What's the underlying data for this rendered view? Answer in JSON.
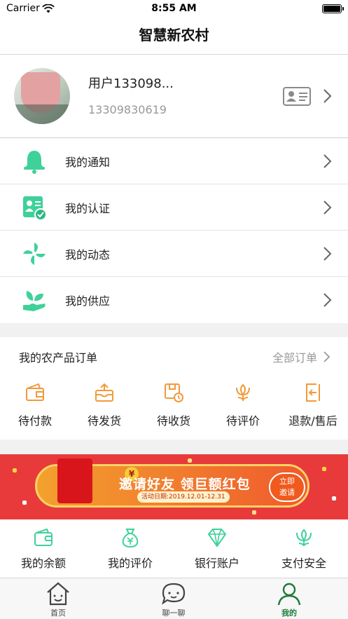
{
  "status_bar": {
    "carrier": "Carrier",
    "time": "8:55 AM"
  },
  "nav": {
    "title": "智慧新农村"
  },
  "profile": {
    "name": "用户133098...",
    "phone": "13309830619"
  },
  "menu": [
    {
      "label": "我的通知",
      "icon": "bell-icon"
    },
    {
      "label": "我的认证",
      "icon": "certification-icon"
    },
    {
      "label": "我的动态",
      "icon": "pinwheel-icon"
    },
    {
      "label": "我的供应",
      "icon": "leaf-hand-icon"
    }
  ],
  "orders": {
    "title": "我的农产品订单",
    "all_label": "全部订单",
    "items": [
      {
        "label": "待付款",
        "icon": "wallet-icon"
      },
      {
        "label": "待发货",
        "icon": "outbox-icon"
      },
      {
        "label": "待收货",
        "icon": "package-clock-icon"
      },
      {
        "label": "待评价",
        "icon": "flower-icon"
      },
      {
        "label": "退款/售后",
        "icon": "return-icon"
      }
    ]
  },
  "banner": {
    "headline": "邀请好友 领巨额红包",
    "date_text": "活动日期:2019.12.01-12.31",
    "button_line1": "立即",
    "button_line2": "邀请",
    "coin_symbol": "¥"
  },
  "wallet": [
    {
      "label": "我的余额",
      "icon": "wallet-icon"
    },
    {
      "label": "我的评价",
      "icon": "money-bag-icon"
    },
    {
      "label": "银行账户",
      "icon": "diamond-icon"
    },
    {
      "label": "支付安全",
      "icon": "lotus-icon"
    }
  ],
  "tabs": [
    {
      "label": "首页",
      "icon": "home-icon",
      "active": false
    },
    {
      "label": "聊一聊",
      "icon": "chat-icon",
      "active": false
    },
    {
      "label": "我的",
      "icon": "user-icon",
      "active": true
    }
  ],
  "colors": {
    "accent_green": "#3fd19a",
    "order_orange": "#f29a3a",
    "tab_active": "#1f7a3a",
    "banner_red": "#e83a3a"
  }
}
